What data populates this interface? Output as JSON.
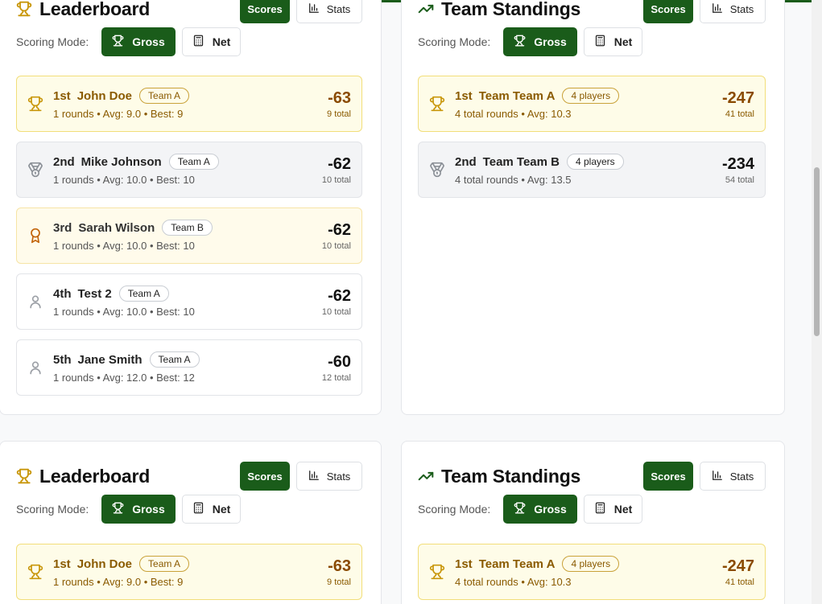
{
  "labels": {
    "leaderboard_title": "Leaderboard",
    "team_title": "Team Standings",
    "scores_tab": "Scores",
    "stats_tab": "Stats",
    "scoring_mode": "Scoring Mode:",
    "gross": "Gross",
    "net": "Net"
  },
  "colors": {
    "brand": "#1a5c1a",
    "gold_row": "#fefce8",
    "silver_row": "#f3f4f6"
  },
  "leaderboard": {
    "rows": [
      {
        "rank": "1st",
        "name": "John Doe",
        "team": "Team A",
        "sub": "1 rounds • Avg: 9.0 • Best: 9",
        "score": "-63",
        "total": "9 total",
        "icon": "trophy-icon",
        "tier": "gold"
      },
      {
        "rank": "2nd",
        "name": "Mike Johnson",
        "team": "Team A",
        "sub": "1 rounds • Avg: 10.0 • Best: 10",
        "score": "-62",
        "total": "10 total",
        "icon": "medal-icon",
        "tier": "silver"
      },
      {
        "rank": "3rd",
        "name": "Sarah Wilson",
        "team": "Team B",
        "sub": "1 rounds • Avg: 10.0 • Best: 10",
        "score": "-62",
        "total": "10 total",
        "icon": "award-icon",
        "tier": "bronze"
      },
      {
        "rank": "4th",
        "name": "Test 2",
        "team": "Team A",
        "sub": "1 rounds • Avg: 10.0 • Best: 10",
        "score": "-62",
        "total": "10 total",
        "icon": "user-icon",
        "tier": "plain"
      },
      {
        "rank": "5th",
        "name": "Jane Smith",
        "team": "Team A",
        "sub": "1 rounds • Avg: 12.0 • Best: 12",
        "score": "-60",
        "total": "12 total",
        "icon": "user-icon",
        "tier": "plain"
      }
    ]
  },
  "teams": {
    "rows": [
      {
        "rank": "1st",
        "name": "Team Team A",
        "badge": "4 players",
        "sub": "4 total rounds • Avg: 10.3",
        "score": "-247",
        "total": "41 total",
        "icon": "trophy-icon",
        "tier": "gold"
      },
      {
        "rank": "2nd",
        "name": "Team Team B",
        "badge": "4 players",
        "sub": "4 total rounds • Avg: 13.5",
        "score": "-234",
        "total": "54 total",
        "icon": "medal-icon",
        "tier": "silver"
      }
    ]
  }
}
